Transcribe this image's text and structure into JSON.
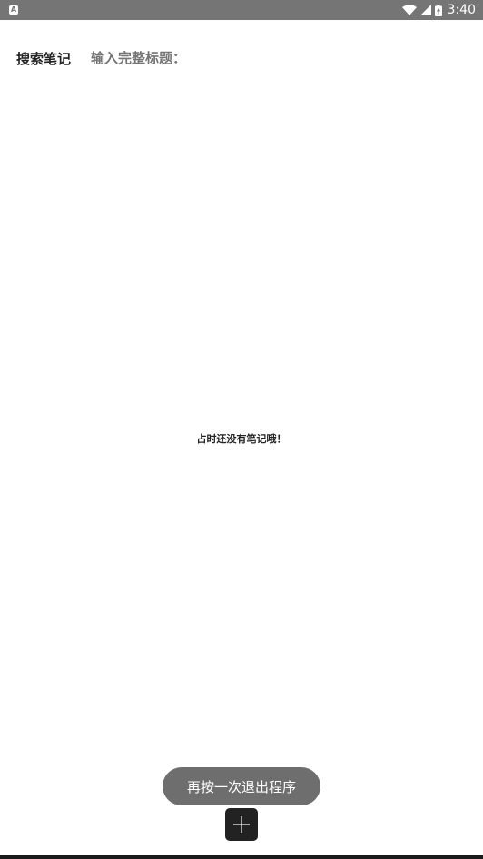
{
  "status_bar": {
    "time": "3:40",
    "notification_icon": "A",
    "icons": [
      "wifi-icon",
      "cell-signal-icon",
      "battery-charging-icon"
    ]
  },
  "search": {
    "label": "搜索笔记",
    "placeholder": "输入完整标题：",
    "value": ""
  },
  "empty_state": {
    "message": "占时还没有笔记哦！"
  },
  "toast": {
    "message": "再按一次退出程序"
  },
  "fab": {
    "icon": "plus-icon"
  },
  "colors": {
    "status_bar": "#757575",
    "background": "#ffffff",
    "text": "#222222",
    "placeholder": "#757575",
    "toast_bg": "#6e6e6e",
    "fab_bg": "#222222"
  }
}
